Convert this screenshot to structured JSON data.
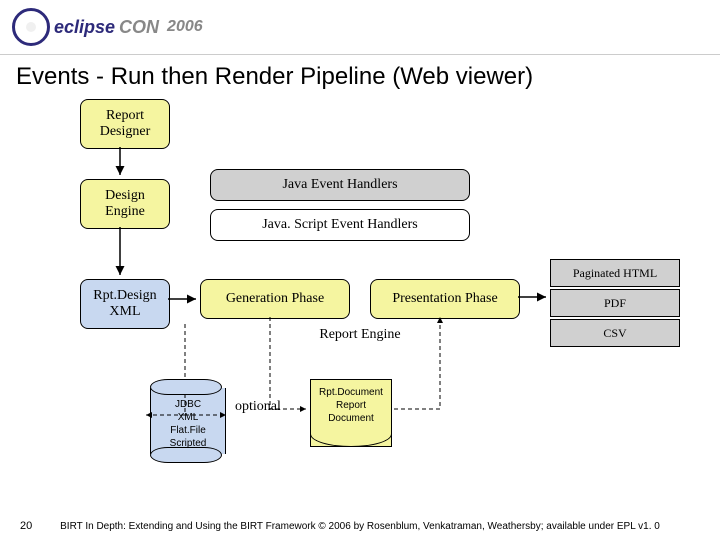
{
  "header": {
    "eclipse": "eclipse",
    "con": "CON",
    "year": "2006"
  },
  "title": "Events - Run then Render Pipeline (Web viewer)",
  "nodes": {
    "report_designer": "Report\nDesigner",
    "design_engine": "Design\nEngine",
    "rpt_design": "Rpt.Design\nXML",
    "java_handlers": "Java Event Handlers",
    "js_handlers": "Java. Script Event Handlers",
    "generation": "Generation Phase",
    "presentation": "Presentation Phase",
    "report_engine": "Report Engine",
    "paginated": "Paginated HTML",
    "pdf": "PDF",
    "csv": "CSV",
    "jdbc": "JDBC\nXML\nFlat.File\nScripted",
    "optional": "optional",
    "rpt_doc": "Rpt.Document\nReport\nDocument"
  },
  "footer": {
    "page": "20",
    "text": "BIRT In Depth: Extending and Using the BIRT Framework © 2006 by Rosenblum, Venkatraman, Weathersby; available under EPL v1. 0"
  }
}
